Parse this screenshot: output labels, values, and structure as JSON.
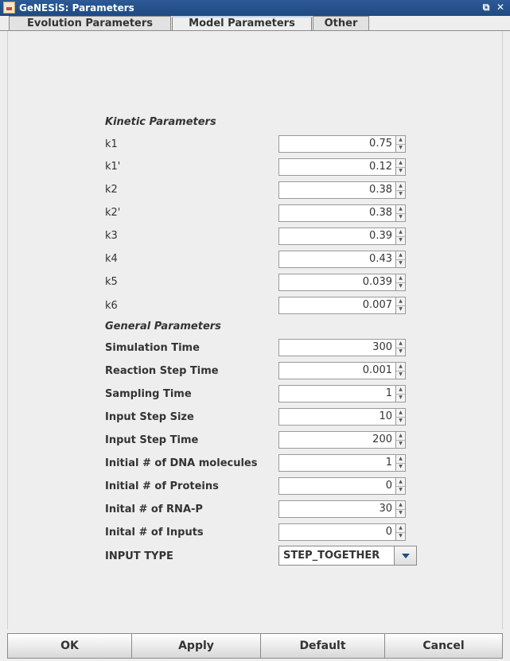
{
  "window": {
    "title": "GeNESiS: Parameters",
    "restore_glyph": "⧉",
    "close_glyph": "✕"
  },
  "tabs": [
    {
      "label": "Evolution Parameters",
      "active": false
    },
    {
      "label": "Model Parameters",
      "active": true
    },
    {
      "label": "Other",
      "active": false
    }
  ],
  "kinetic": {
    "title": "Kinetic Parameters",
    "rows": [
      {
        "label": "k1",
        "value": "0.75"
      },
      {
        "label": "k1'",
        "value": "0.12"
      },
      {
        "label": "k2",
        "value": "0.38"
      },
      {
        "label": "k2'",
        "value": "0.38"
      },
      {
        "label": "k3",
        "value": "0.39"
      },
      {
        "label": "k4",
        "value": "0.43"
      },
      {
        "label": "k5",
        "value": "0.039"
      },
      {
        "label": "k6",
        "value": "0.007"
      }
    ]
  },
  "general": {
    "title": "General Parameters",
    "rows": [
      {
        "label": "Simulation Time",
        "value": "300"
      },
      {
        "label": "Reaction Step Time",
        "value": "0.001"
      },
      {
        "label": "Sampling Time",
        "value": "1"
      },
      {
        "label": "Input Step Size",
        "value": "10"
      },
      {
        "label": "Input Step Time",
        "value": "200"
      },
      {
        "label": "Initial # of DNA molecules",
        "value": "1"
      },
      {
        "label": "Initial # of Proteins",
        "value": "0"
      },
      {
        "label": "Inital # of RNA-P",
        "value": "30"
      },
      {
        "label": "Inital # of Inputs",
        "value": "0"
      }
    ],
    "input_type": {
      "label": "INPUT TYPE",
      "value": "STEP_TOGETHER"
    }
  },
  "buttons": {
    "ok": "OK",
    "apply": "Apply",
    "default": "Default",
    "cancel": "Cancel"
  }
}
